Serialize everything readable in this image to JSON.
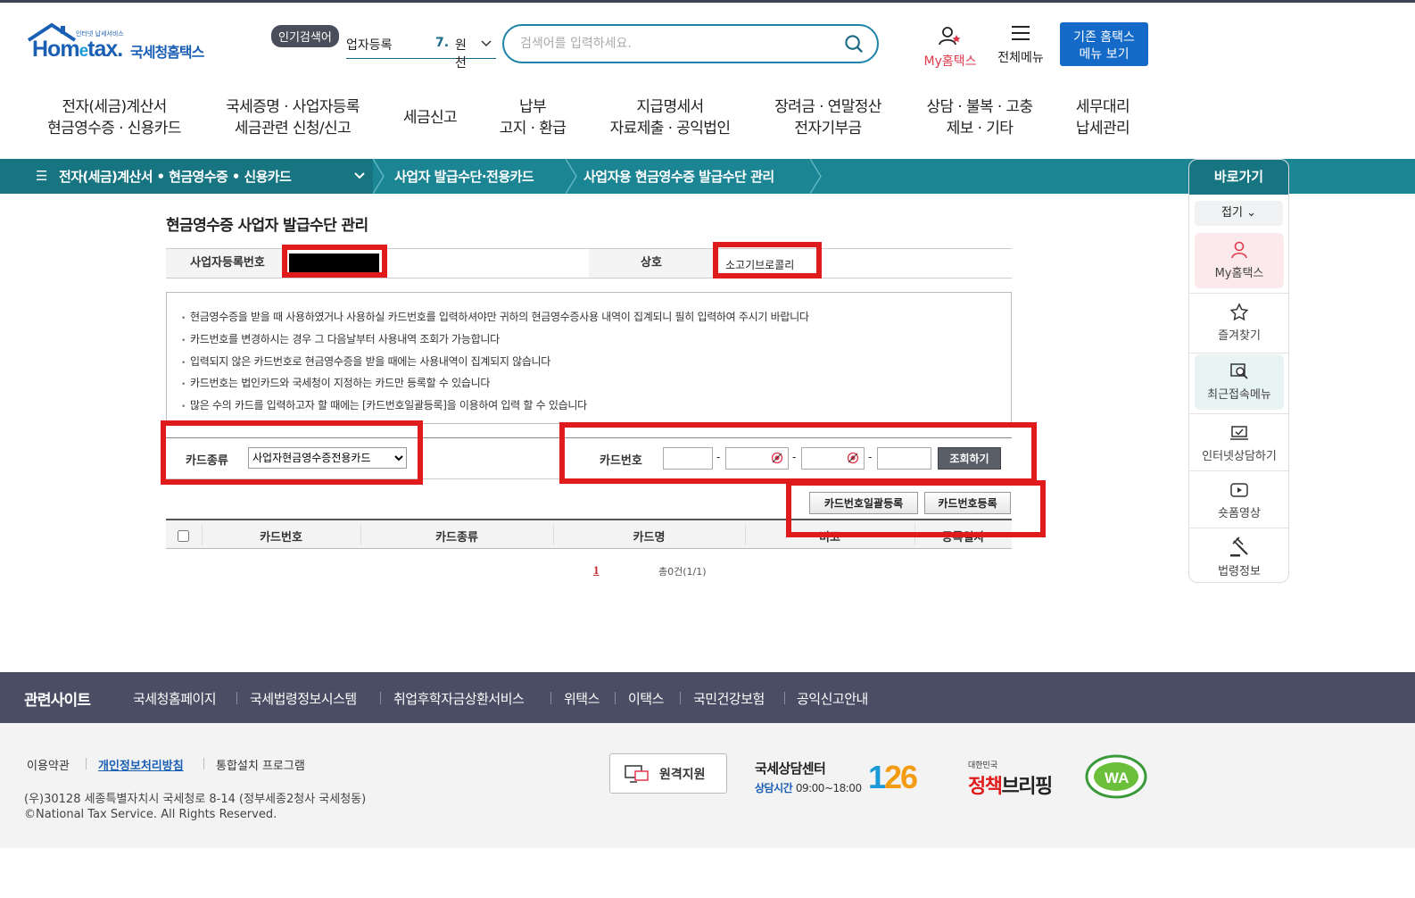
{
  "header": {
    "logo_tiny": "인터넷 납세서비스",
    "logo_brand_a": "Hom",
    "logo_brand_e": "e",
    "logo_brand_b": "tax.",
    "logo_kor": "국세청홈택스",
    "hot_badge": "인기검색어",
    "hot_word": "업자등록",
    "hot_rank": "7.",
    "hot_word2": "원천",
    "search_placeholder": "검색어를 입력하세요.",
    "my_label": "My홈택스",
    "allmenu_label": "전체메뉴",
    "oldmenu_line1": "기존 홈택스",
    "oldmenu_line2": "메뉴 보기"
  },
  "gnb": [
    {
      "l1": "전자(세금)계산서",
      "l2": "현금영수증 · 신용카드"
    },
    {
      "l1": "국세증명 · 사업자등록",
      "l2": "세금관련 신청/신고"
    },
    {
      "l1": "세금신고",
      "l2": ""
    },
    {
      "l1": "납부",
      "l2": "고지 · 환급"
    },
    {
      "l1": "지급명세서",
      "l2": "자료제출 · 공익법인"
    },
    {
      "l1": "장려금 · 연말정산",
      "l2": "전자기부금"
    },
    {
      "l1": "상담 · 불복 · 고충",
      "l2": "제보 · 기타"
    },
    {
      "l1": "세무대리",
      "l2": "납세관리"
    }
  ],
  "location": {
    "level1": "전자(세금)계산서 • 현금영수증 • 신용카드",
    "level2": "사업자 발급수단·전용카드",
    "level3": "사업자용 현금영수증 발급수단 관리"
  },
  "quick": {
    "title": "바로가기",
    "fold": "접기",
    "items": [
      "My홈택스",
      "즐겨찾기",
      "최근접속메뉴",
      "인터넷상담하기",
      "숏폼영상",
      "법령정보"
    ]
  },
  "page": {
    "title": "현금영수증 사업자 발급수단 관리",
    "biz_no_label": "사업자등록번호",
    "name_label": "상호",
    "name_value": "소고기브로콜리",
    "notices": [
      "현금영수증을 받을 때 사용하였거나 사용하실 카드번호를 입력하셔야만 귀하의 현금영수증사용 내역이 집계되니 필히 입력하여 주시기 바랍니다",
      "카드번호를 변경하시는 경우 그 다음날부터 사용내역 조회가 가능합니다",
      "입력되지 않은 카드번호로 현금영수증을 받을 때에는 사용내역이 집계되지 않습니다",
      "카드번호는 법인카드와 국세청이 지정하는 카드만 등록할 수 있습니다",
      "많은 수의 카드를 입력하고자 할 때에는 [카드번호일괄등록]을 이용하여 입력 할 수 있습니다"
    ],
    "card_type_label": "카드종류",
    "card_type_selected": "사업자현금영수증전용카드",
    "card_no_label": "카드번호",
    "dash": "-",
    "search_button": "조회하기",
    "bulk_register_button": "카드번호일괄등록",
    "register_button": "카드번호등록",
    "grid_headers": [
      "카드번호",
      "카드종류",
      "카드명",
      "비고",
      "등록일자"
    ],
    "pager_current": "1",
    "total": "총0건(1/1)"
  },
  "footer": {
    "related_title": "관련사이트",
    "related_links": [
      "국세청홈페이지",
      "국세법령정보시스템",
      "취업후학자금상환서비스",
      "위택스",
      "이택스",
      "국민건강보험",
      "공익신고안내"
    ],
    "links": [
      "이용약관",
      "개인정보처리방침",
      "통합설치 프로그램"
    ],
    "address": "(우)30128 세종특별자치시 국세청로 8-14 (정부세종2청사 국세청동)",
    "copyright": "©National Tax Service. All Rights Reserved.",
    "remote_support": "원격지원",
    "call_center": "국세상담센터",
    "call_hours_label": "상담시간",
    "call_hours": "09:00~18:00",
    "call_number_a": "1",
    "call_number_b": "26",
    "briefing_small": "대한민국",
    "briefing_a": "정책",
    "briefing_b": "브리핑",
    "wa_mark": "WA"
  },
  "colors": {
    "teal": "#1b8593",
    "teal_dark": "#177582",
    "brand_blue": "#1569c7",
    "highlight_red": "#e01b1b",
    "footer_bar": "#4a4d63"
  }
}
